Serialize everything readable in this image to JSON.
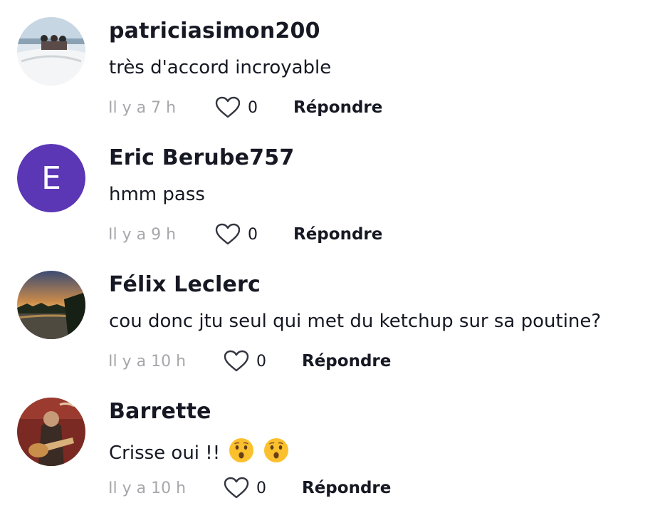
{
  "comments": [
    {
      "username": "patriciasimon200",
      "text": "très d'accord incroyable",
      "time": "Il y a 7 h",
      "likes": "0",
      "reply_label": "Répondre"
    },
    {
      "username": "Eric Berube757",
      "avatar_letter": "E",
      "avatar_color": "#5b36b5",
      "text": "hmm pass",
      "time": "Il y a 9 h",
      "likes": "0",
      "reply_label": "Répondre"
    },
    {
      "username": "Félix Leclerc",
      "text": "cou donc jtu seul qui met du ketchup sur sa poutine?",
      "time": "Il y a 10 h",
      "likes": "0",
      "reply_label": "Répondre"
    },
    {
      "username": "Barrette",
      "text": "Crisse oui !!",
      "emojis": [
        "hushed-face-emoji",
        "hushed-face-emoji"
      ],
      "time": "Il y a 10 h",
      "likes": "0",
      "reply_label": "Répondre"
    }
  ],
  "icons": {
    "like": "heart-outline-icon"
  }
}
